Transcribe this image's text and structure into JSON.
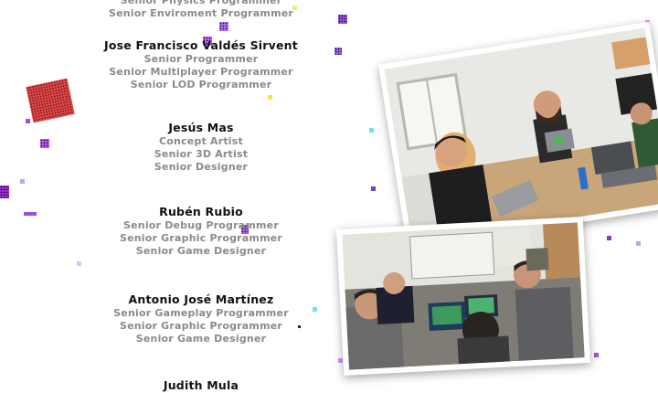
{
  "credits": [
    {
      "name": "",
      "roles": [
        "Senior Physics Programmer",
        "Senior Enviroment Programmer"
      ]
    },
    {
      "name": "Jose Francisco Valdés Sirvent",
      "roles": [
        "Senior Programmer",
        "Senior Multiplayer Programmer",
        "Senior LOD Programmer"
      ]
    },
    {
      "name": "Jesús Mas",
      "roles": [
        "Concept Artist",
        "Senior 3D Artist",
        "Senior Designer"
      ]
    },
    {
      "name": "Rubén Rubio",
      "roles": [
        "Senior Debug Programmer",
        "Senior Graphic Programmer",
        "Senior Game Designer"
      ]
    },
    {
      "name": "Antonio José Martínez",
      "roles": [
        "Senior Gameplay Programmer",
        "Senior Graphic Programmer",
        "Senior Game Designer"
      ]
    },
    {
      "name": "Judith Mula",
      "roles": []
    }
  ],
  "colors": {
    "background": "#ffffff",
    "name_text": "#111111",
    "role_text": "#8a8a8a",
    "sparkle_purple": "#8a2bd0",
    "sparkle_yellow": "#f2e63a",
    "sparkle_cyan": "#6fe0ff",
    "red_glow": "#e02020"
  },
  "photos": [
    {
      "icon": "team-working-photo"
    },
    {
      "icon": "students-playing-photo"
    }
  ]
}
